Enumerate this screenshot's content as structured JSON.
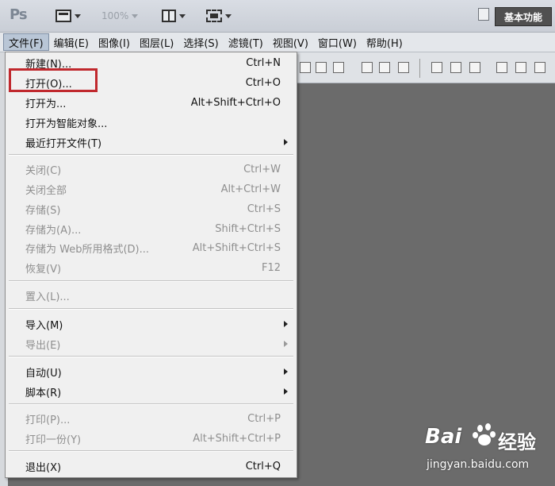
{
  "app": {
    "logo": "Ps",
    "zoom": "100%",
    "workspace": "基本功能"
  },
  "menubar": [
    "文件(F)",
    "编辑(E)",
    "图像(I)",
    "图层(L)",
    "选择(S)",
    "滤镜(T)",
    "视图(V)",
    "窗口(W)",
    "帮助(H)"
  ],
  "file_menu": {
    "items": [
      {
        "label": "新建(N)...",
        "shortcut": "Ctrl+N",
        "enabled": true
      },
      {
        "label": "打开(O)...",
        "shortcut": "Ctrl+O",
        "enabled": true,
        "highlighted": true
      },
      {
        "label": "打开为...",
        "shortcut": "Alt+Shift+Ctrl+O",
        "enabled": true
      },
      {
        "label": "打开为智能对象...",
        "shortcut": "",
        "enabled": true
      },
      {
        "label": "最近打开文件(T)",
        "shortcut": "",
        "enabled": true,
        "submenu": true
      },
      {
        "label": "关闭(C)",
        "shortcut": "Ctrl+W",
        "enabled": false
      },
      {
        "label": "关闭全部",
        "shortcut": "Alt+Ctrl+W",
        "enabled": false
      },
      {
        "label": "存储(S)",
        "shortcut": "Ctrl+S",
        "enabled": false
      },
      {
        "label": "存储为(A)...",
        "shortcut": "Shift+Ctrl+S",
        "enabled": false
      },
      {
        "label": "存储为 Web所用格式(D)...",
        "shortcut": "Alt+Shift+Ctrl+S",
        "enabled": false
      },
      {
        "label": "恢复(V)",
        "shortcut": "F12",
        "enabled": false
      },
      {
        "label": "置入(L)...",
        "shortcut": "",
        "enabled": false
      },
      {
        "label": "导入(M)",
        "shortcut": "",
        "enabled": true,
        "submenu": true
      },
      {
        "label": "导出(E)",
        "shortcut": "",
        "enabled": false,
        "submenu": true
      },
      {
        "label": "自动(U)",
        "shortcut": "",
        "enabled": true,
        "submenu": true
      },
      {
        "label": "脚本(R)",
        "shortcut": "",
        "enabled": true,
        "submenu": true
      },
      {
        "label": "打印(P)...",
        "shortcut": "Ctrl+P",
        "enabled": false
      },
      {
        "label": "打印一份(Y)",
        "shortcut": "Alt+Shift+Ctrl+P",
        "enabled": false
      },
      {
        "label": "退出(X)",
        "shortcut": "Ctrl+Q",
        "enabled": true
      }
    ]
  },
  "watermark": {
    "logo": "Bai",
    "site": "经验",
    "url": "jingyan.baidu.com"
  },
  "colors": {
    "highlight_box": "#c0282d",
    "canvas_bg": "#6b6b6b"
  }
}
